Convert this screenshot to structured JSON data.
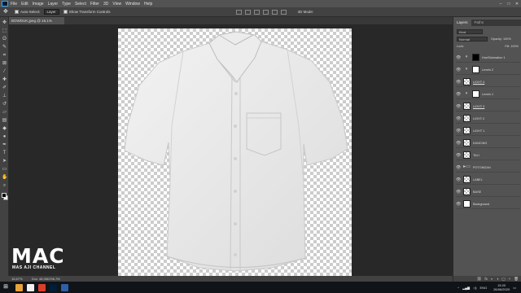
{
  "menubar": {
    "items": [
      "File",
      "Edit",
      "Image",
      "Layer",
      "Type",
      "Select",
      "Filter",
      "3D",
      "View",
      "Window",
      "Help"
    ],
    "window_controls": [
      "–",
      "□",
      "✕"
    ]
  },
  "options_bar": {
    "auto_select": "Auto-Select:",
    "auto_select_target": "Layer",
    "show_transform": "Show Transform Controls",
    "mode_3d": "3D Mode:"
  },
  "document": {
    "tab_title": "BOWDUK.jpeg @ 16.1% (RGB/8) *",
    "zoom": "16,67%",
    "doc_size": "Doc: 48,0M/296,7M"
  },
  "layers_panel": {
    "tabs": [
      "Layers",
      "Paths"
    ],
    "search_placeholder": "Kind",
    "blend_mode": "Normal",
    "opacity_label": "Opacity: 100%",
    "lock_label": "Lock:",
    "fill_label": "Fill: 100%",
    "layers": [
      {
        "name": "Hue/Saturation 1",
        "thumb": "adj",
        "mask": "black",
        "underline": false
      },
      {
        "name": "Levels 2",
        "thumb": "adj",
        "mask": "white",
        "underline": false
      },
      {
        "name": "LIGHT 4",
        "thumb": "checker",
        "mask": "",
        "underline": true
      },
      {
        "name": "Levels 1",
        "thumb": "adj",
        "mask": "white",
        "underline": false
      },
      {
        "name": "LIGHT 3",
        "thumb": "checker",
        "mask": "",
        "underline": true
      },
      {
        "name": "LIGHT 2",
        "thumb": "checker",
        "mask": "",
        "underline": false
      },
      {
        "name": "LIGHT 1",
        "thumb": "checker",
        "mask": "",
        "underline": false
      },
      {
        "name": "KANCING",
        "thumb": "checker",
        "mask": "",
        "underline": false
      },
      {
        "name": "TALI",
        "thumb": "checker",
        "mask": "",
        "underline": false
      },
      {
        "name": "POTONGAN",
        "thumb": "folder",
        "mask": "",
        "underline": false
      },
      {
        "name": "LABEL",
        "thumb": "checker",
        "mask": "",
        "underline": false
      },
      {
        "name": "BASE",
        "thumb": "checker",
        "mask": "",
        "underline": false
      },
      {
        "name": "Background",
        "thumb": "white",
        "mask": "",
        "underline": false
      }
    ],
    "footer_icons": [
      "⛓",
      "fx",
      "◐",
      "◑",
      "▢",
      "+",
      "🗑"
    ]
  },
  "taskbar": {
    "tray_lang": "ENG",
    "time": "15:20",
    "date": "26/06/2020"
  },
  "watermark": {
    "title": "MAC",
    "subtitle": "MAS AJI CHANNEL"
  },
  "colors": {
    "taskbar_icons": [
      "#e8a33c",
      "#f3f3f3",
      "#d93f2b",
      "#001e36",
      "#2f5fa8"
    ]
  }
}
